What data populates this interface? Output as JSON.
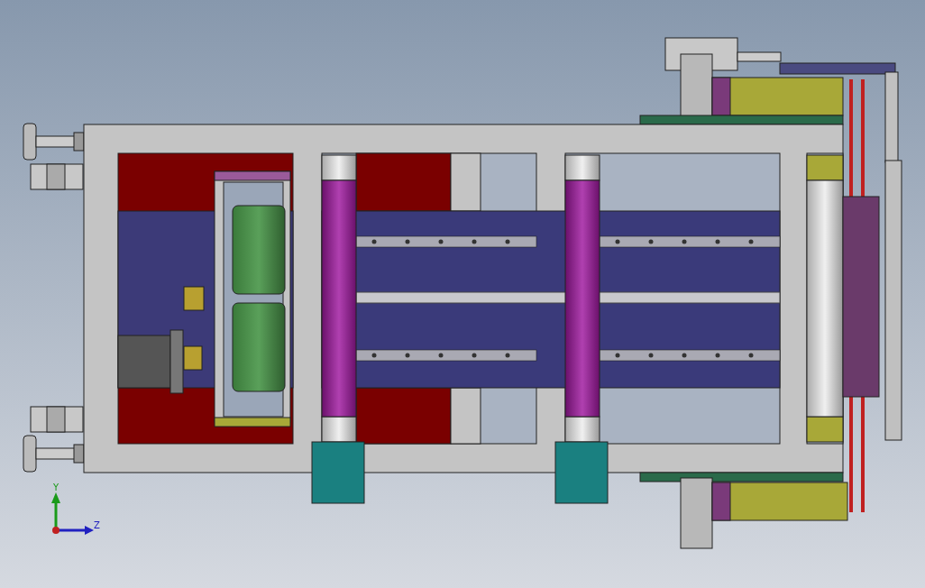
{
  "viewport": {
    "axis_triad": {
      "labels": [
        "Y",
        "Z"
      ]
    }
  }
}
